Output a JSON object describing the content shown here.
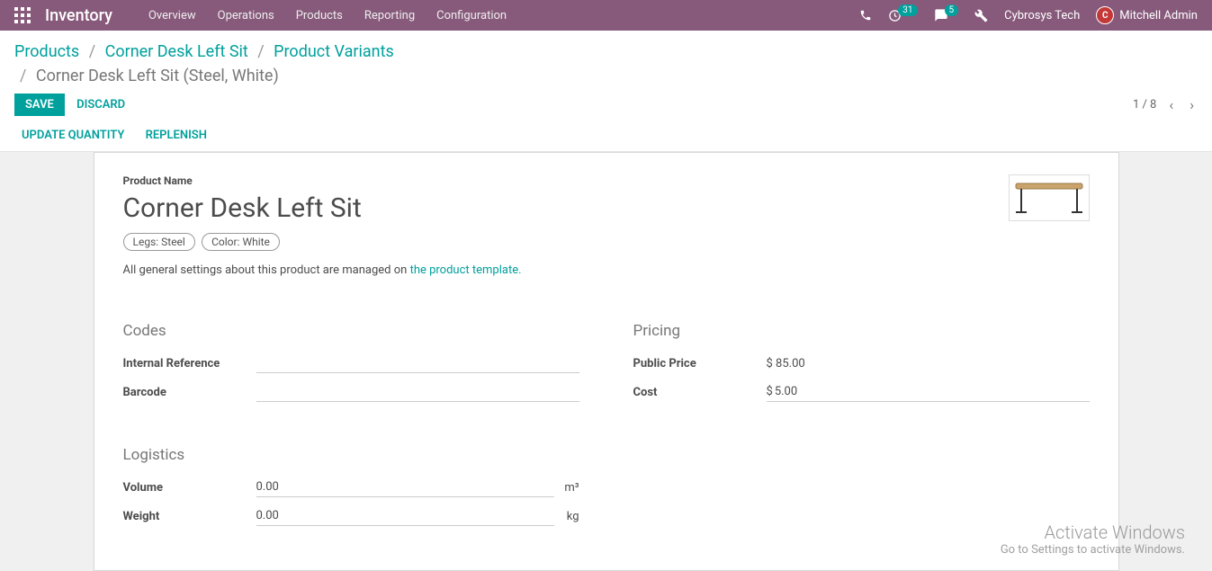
{
  "navbar": {
    "brand": "Inventory",
    "menu": [
      "Overview",
      "Operations",
      "Products",
      "Reporting",
      "Configuration"
    ],
    "activities_badge": "31",
    "messages_badge": "5",
    "company": "Cybrosys Tech",
    "user": "Mitchell Admin"
  },
  "breadcrumb": {
    "items": [
      "Products",
      "Corner Desk Left Sit",
      "Product Variants"
    ],
    "current": "Corner Desk Left Sit (Steel, White)"
  },
  "buttons": {
    "save": "SAVE",
    "discard": "DISCARD",
    "update_quantity": "UPDATE QUANTITY",
    "replenish": "REPLENISH"
  },
  "pager": {
    "text": "1 / 8"
  },
  "product": {
    "label": "Product Name",
    "name": "Corner Desk Left Sit",
    "tags": [
      "Legs: Steel",
      "Color: White"
    ],
    "info_prefix": "All general settings about this product are managed on ",
    "info_link": "the product template."
  },
  "sections": {
    "codes": {
      "title": "Codes",
      "internal_reference_label": "Internal Reference",
      "internal_reference_value": "",
      "barcode_label": "Barcode",
      "barcode_value": ""
    },
    "pricing": {
      "title": "Pricing",
      "public_price_label": "Public Price",
      "public_price_value": "$ 85.00",
      "cost_label": "Cost",
      "cost_prefix": "$",
      "cost_value": "5.00"
    },
    "logistics": {
      "title": "Logistics",
      "volume_label": "Volume",
      "volume_value": "0.00",
      "volume_unit": "m³",
      "weight_label": "Weight",
      "weight_value": "0.00",
      "weight_unit": "kg"
    }
  },
  "watermark": {
    "line1": "Activate Windows",
    "line2": "Go to Settings to activate Windows."
  }
}
